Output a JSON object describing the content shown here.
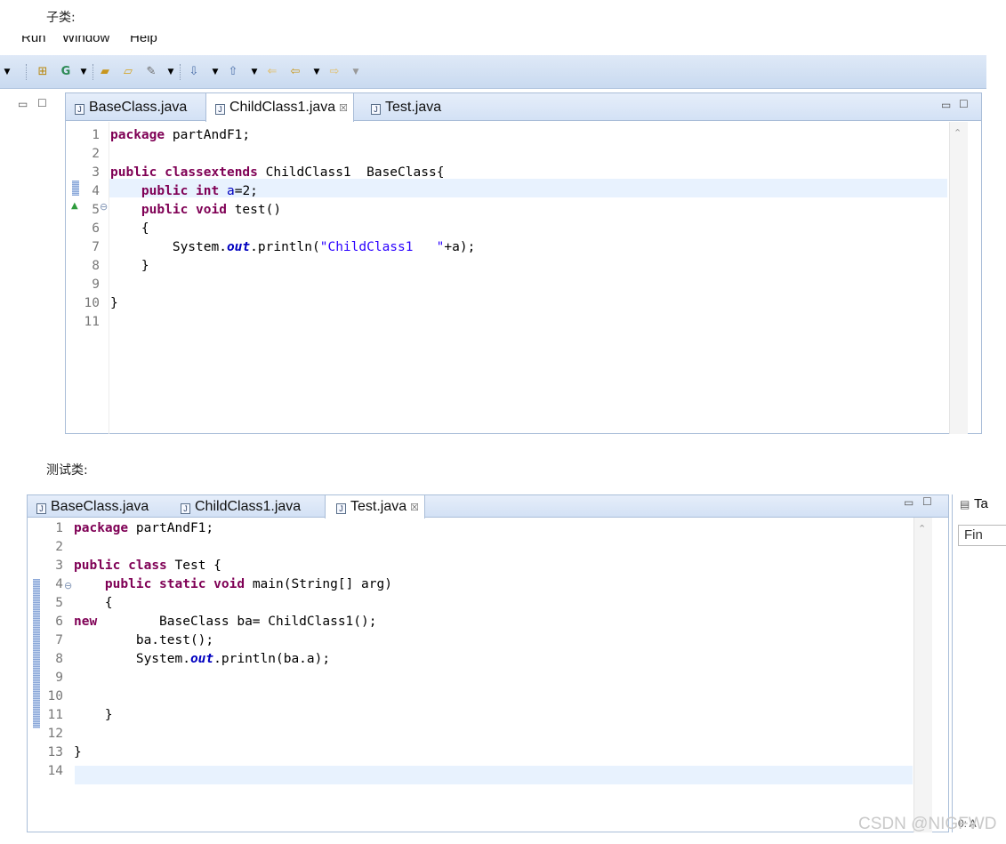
{
  "captions": {
    "child": "子类:",
    "test": "测试类:"
  },
  "menu": {
    "run": "Run",
    "window": "Window",
    "help": "Help"
  },
  "tabs1": [
    {
      "label": "BaseClass.java"
    },
    {
      "label": "ChildClass1.java",
      "close": "☒"
    },
    {
      "label": "Test.java"
    }
  ],
  "tabs2": [
    {
      "label": "BaseClass.java"
    },
    {
      "label": "ChildClass1.java"
    },
    {
      "label": "Test.java",
      "close": "☒"
    }
  ],
  "code1": {
    "line_numbers": [
      "1",
      "2",
      "3",
      "4",
      "5",
      "6",
      "7",
      "8",
      "9",
      "10",
      "11"
    ],
    "lines": [
      {
        "k1": "package",
        "t1": " partAndF1;"
      },
      {
        "t1": ""
      },
      {
        "k1": "public",
        "t0": " ",
        "k2": "class",
        "t1": " ChildClass1 ",
        "k3": "extends",
        "t2": " BaseClass{"
      },
      {
        "ind": "    ",
        "k1": "public",
        "t0": " ",
        "k2": "int",
        "t0b": " ",
        "f": "a",
        "t1": "=2;"
      },
      {
        "ind": "    ",
        "k1": "public",
        "t0": " ",
        "k2": "void",
        "t1": " test()"
      },
      {
        "t1": "    {"
      },
      {
        "t1": "        System.",
        "sf": "out",
        "t2": ".println(",
        "s": "\"ChildClass1   \"",
        "t3": "+a);"
      },
      {
        "t1": "    }"
      },
      {
        "t1": ""
      },
      {
        "t1": "}"
      },
      {
        "t1": ""
      }
    ],
    "marker_glyph": "5⊖"
  },
  "code2": {
    "line_numbers": [
      "1",
      "2",
      "3",
      "4",
      "5",
      "6",
      "7",
      "8",
      "9",
      "10",
      "11",
      "12",
      "13",
      "14"
    ],
    "lines": [
      {
        "k1": "package",
        "t1": " partAndF1;"
      },
      {
        "t1": ""
      },
      {
        "k1": "public",
        "t0": " ",
        "k2": "class",
        "t1": " Test {"
      },
      {
        "ind": "    ",
        "k1": "public",
        "t0": " ",
        "k2": "static",
        "t0b": " ",
        "k3": "void",
        "t1": " main(String[] arg)"
      },
      {
        "t1": "    {"
      },
      {
        "t1": "        BaseClass ba=",
        "k1": "new",
        "t2": " ChildClass1();"
      },
      {
        "t1": "        ba.test();"
      },
      {
        "t1": "        System.",
        "sf": "out",
        "t2": ".println(ba.a);"
      },
      {
        "t1": ""
      },
      {
        "t1": ""
      },
      {
        "t1": "    }"
      },
      {
        "t1": ""
      },
      {
        "t1": "}"
      },
      {
        "t1": ""
      }
    ]
  },
  "side": {
    "tab_label": "Ta",
    "find_label": "Fin",
    "bottom_label": "0:  A"
  },
  "watermark": "CSDN @NIGFWD",
  "colors": {
    "keyword": "#7f0055",
    "field": "#0000c0",
    "string": "#2a00ff",
    "tabbar": "#d3e1f5",
    "current_line": "#e8f2fe"
  }
}
